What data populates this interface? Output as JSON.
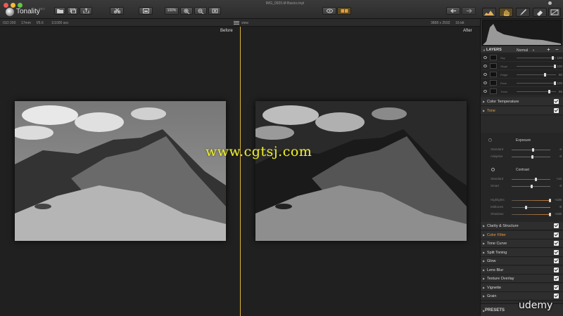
{
  "app": {
    "name": "Tonality",
    "version": "PRO",
    "window_title": "IMG_0920.tif-Basics.tnpl"
  },
  "toolbar": {
    "zoom": "100%"
  },
  "infobar": {
    "iso": "ISO 200",
    "focal": "17mm",
    "aperture": "f/5.6",
    "shutter": "1/1000 sec",
    "view_label": "view",
    "dimensions": "3888 x 2592",
    "bit_depth": "16-bit"
  },
  "canvas": {
    "before_label": "Before",
    "after_label": "After"
  },
  "watermark": "www.cgtsj.com",
  "udemy": "udemy",
  "layers": {
    "title": "LAYERS",
    "blend_mode": "Normal",
    "add": "+",
    "remove": "−",
    "rows": [
      {
        "name": "Sky",
        "value": "100"
      },
      {
        "name": "Slope",
        "value": "100"
      },
      {
        "name": "Ridge",
        "value": "80"
      },
      {
        "name": "Rock",
        "value": "100"
      },
      {
        "name": "Trees",
        "value": "85"
      }
    ]
  },
  "sections_top": [
    {
      "name": "Color Temperature",
      "active": false
    },
    {
      "name": "Tone",
      "active": true
    }
  ],
  "tone": {
    "exposure_title": "Exposure",
    "contrast_title": "Contrast",
    "sliders": [
      {
        "label": "Standard",
        "value": "-4",
        "pos": 0.55
      },
      {
        "label": "Adaptive",
        "value": "-3",
        "pos": 0.53
      },
      {
        "label": "Standard",
        "value": "+14",
        "pos": 0.62
      },
      {
        "label": "Smart",
        "value": "-3",
        "pos": 0.5
      },
      {
        "label": "Highlights",
        "value": "+100",
        "pos": 1.0
      },
      {
        "label": "Midtones",
        "value": "-8",
        "pos": 0.35
      },
      {
        "label": "Shadows",
        "value": "+100",
        "pos": 1.0
      },
      {
        "label": "Whites",
        "value": "-7",
        "pos": 0.48
      },
      {
        "label": "Blacks",
        "value": "+14",
        "pos": 0.58
      }
    ]
  },
  "sections_bottom": [
    {
      "name": "Clarity & Structure",
      "active": false
    },
    {
      "name": "Color Filter",
      "active": true
    },
    {
      "name": "Tone Curve",
      "active": false
    },
    {
      "name": "Split Toning",
      "active": false
    },
    {
      "name": "Glow",
      "active": false
    },
    {
      "name": "Lens Blur",
      "active": false
    },
    {
      "name": "Texture Overlay",
      "active": false
    },
    {
      "name": "Vignette",
      "active": false
    },
    {
      "name": "Grain",
      "active": false
    }
  ],
  "presets": {
    "label": "PRESETS"
  }
}
